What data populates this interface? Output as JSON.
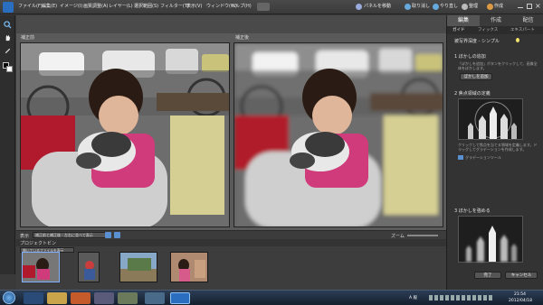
{
  "app": {
    "title": "Photoshop Elements"
  },
  "menus": [
    "ファイル(F)",
    "編集(E)",
    "イメージ(I)",
    "画質調整(A)",
    "レイヤー(L)",
    "選択範囲(S)",
    "フィルター(T)",
    "表示(V)",
    "ウィンドウ(W)",
    "ヘルプ(H)"
  ],
  "topright": {
    "panel_label": "パネルを移動",
    "undo_label": "取り消し",
    "redo_label": "やり直し",
    "organizer_label": "整理",
    "create_label": "作成"
  },
  "workspace": {
    "before_label": "補正前",
    "after_label": "補正後",
    "view_label": "表示",
    "view_value": "補正前と補正後 - 左右に並べて表示",
    "zoom_label": "ズーム",
    "bin_label": "プロジェクトビン",
    "bin_dropdown": "開いているファイルを表示"
  },
  "rightpanel": {
    "tabs": [
      "編集",
      "作成",
      "配信"
    ],
    "subtabs": [
      "ガイド",
      "フィックス",
      "エキスパート"
    ],
    "title": "被写界深度 - シンプル",
    "step1_title": "1 ぼかしの追加",
    "step1_desc": "「ぼかしを追加」ボタンをクリックして、画像全体をぼかします。",
    "step1_button": "ぼかしを追加",
    "step2_title": "2 焦点領域の定義",
    "step2_desc": "クリックして焦点を当てる領域を定義します。ドラッグしてグラデーションを作成します。",
    "step2_link": "グラデーションツール",
    "step3_title": "3 ぼかしを強める",
    "done_button": "完了",
    "cancel_button": "キャンセル"
  },
  "taskbar": {
    "tray_lang": "A 般",
    "clock_time": "21:54",
    "clock_date": "2012/04/18"
  }
}
